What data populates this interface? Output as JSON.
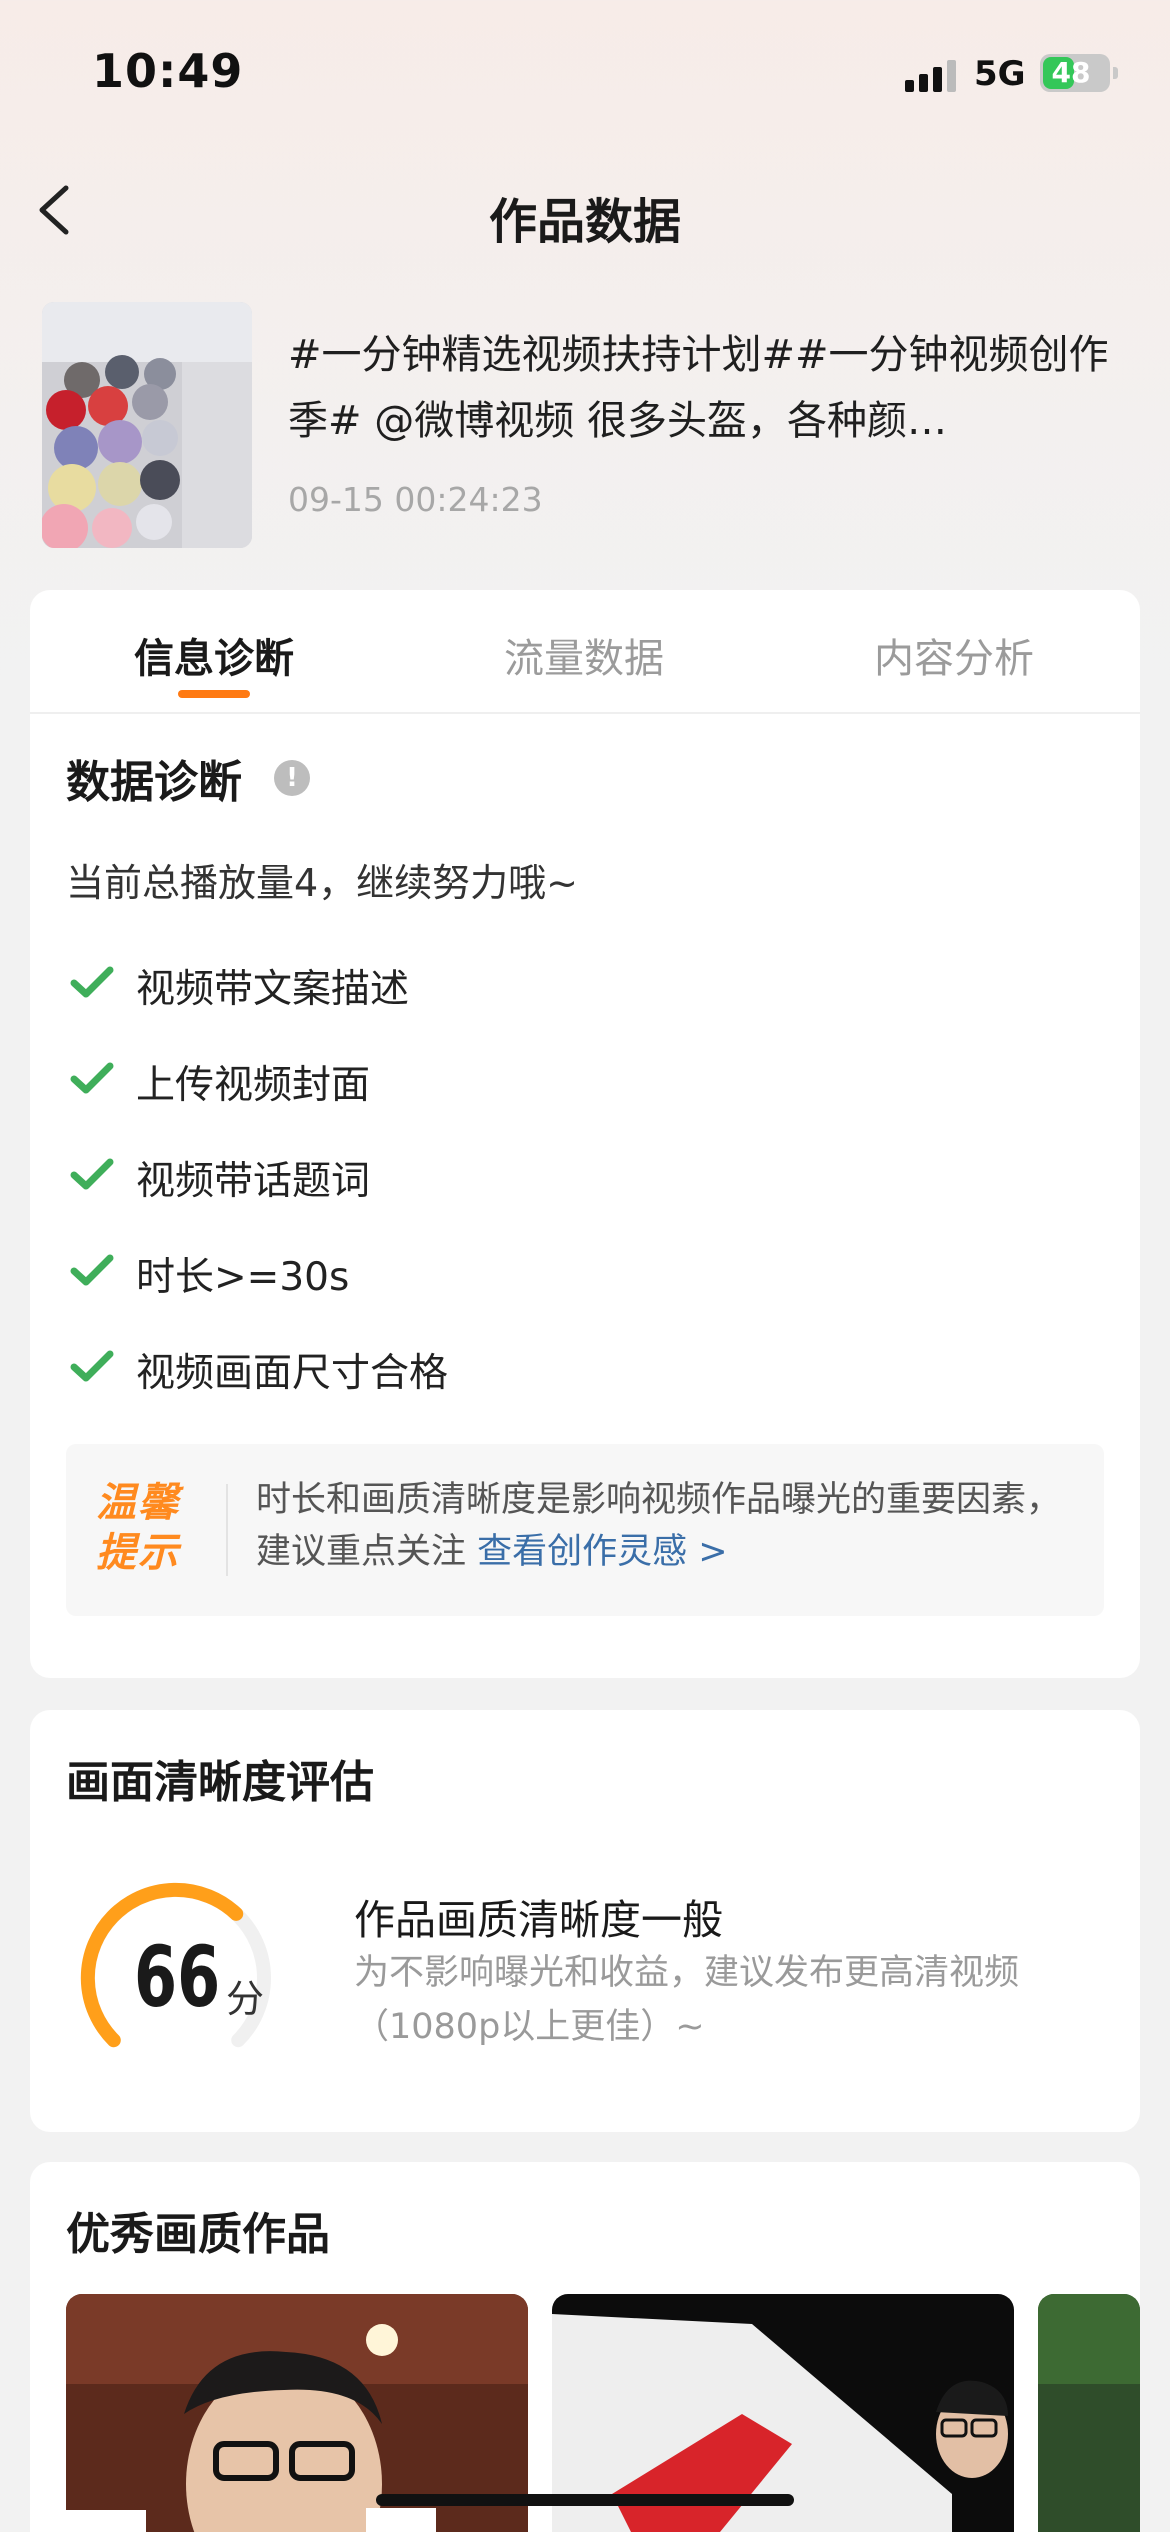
{
  "status_bar": {
    "time": "10:49",
    "network": "5G",
    "battery": "48"
  },
  "nav": {
    "title": "作品数据"
  },
  "post": {
    "title": "#一分钟精选视频扶持计划##一分钟视频创作季# @微博视频 很多头盔，各种颜…",
    "timestamp": "09-15 00:24:23"
  },
  "tabs": [
    {
      "label": "信息诊断",
      "active": true
    },
    {
      "label": "流量数据",
      "active": false
    },
    {
      "label": "内容分析",
      "active": false
    }
  ],
  "diagnosis": {
    "title": "数据诊断",
    "info_icon": "!",
    "summary": "当前总播放量4，继续努力哦~",
    "checks": [
      {
        "label": "视频带文案描述",
        "icon": "check-icon"
      },
      {
        "label": "上传视频封面",
        "icon": "check-icon"
      },
      {
        "label": "视频带话题词",
        "icon": "check-icon"
      },
      {
        "label": "时长>=30s",
        "icon": "check-icon"
      },
      {
        "label": "视频画面尺寸合格",
        "icon": "check-icon"
      }
    ],
    "tip": {
      "badge_line1": "温馨",
      "badge_line2": "提示",
      "text": "时长和画质清晰度是影响视频作品曝光的重要因素，建议重点关注",
      "link": "查看创作灵感 >"
    }
  },
  "quality": {
    "title": "画面清晰度评估",
    "score": "66",
    "score_fraction": 0.66,
    "score_unit": "分",
    "headline": "作品画质清晰度一般",
    "description": "为不影响曝光和收益，建议发布更高清视频（1080p以上更佳）~"
  },
  "excellent": {
    "title": "优秀画质作品"
  },
  "colors": {
    "accent": "#ff7a12",
    "check": "#3fae5a",
    "link": "#3a6ea8",
    "gauge_track": "#f0f0f0",
    "gauge_fill": "#ff9f1a"
  }
}
